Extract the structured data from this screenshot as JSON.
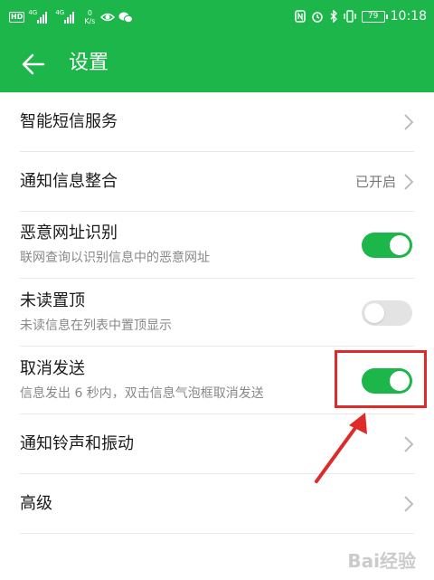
{
  "status_bar": {
    "hd": "HD",
    "net1": "4G",
    "net2": "4G",
    "speed_value": "0",
    "speed_unit": "K/s",
    "battery": "79",
    "time": "10:18"
  },
  "header": {
    "title": "设置"
  },
  "settings": [
    {
      "label": "智能短信服务",
      "control": "chevron"
    },
    {
      "label": "通知信息整合",
      "value": "已开启",
      "control": "chevron"
    },
    {
      "label": "恶意网址识别",
      "subtitle": "联网查询以识别信息中的恶意网址",
      "control": "toggle",
      "on": true
    },
    {
      "label": "未读置顶",
      "subtitle": "未读信息在列表中置顶显示",
      "control": "toggle",
      "on": false
    },
    {
      "label": "取消发送",
      "subtitle": "信息发出 6 秒内，双击信息气泡框取消发送",
      "control": "toggle",
      "on": true
    },
    {
      "label": "通知铃声和振动",
      "control": "chevron"
    },
    {
      "label": "高级",
      "control": "chevron"
    }
  ],
  "watermark": "Bai经验",
  "colors": {
    "accent": "#1cb64a",
    "annotation": "#e02a2a"
  }
}
